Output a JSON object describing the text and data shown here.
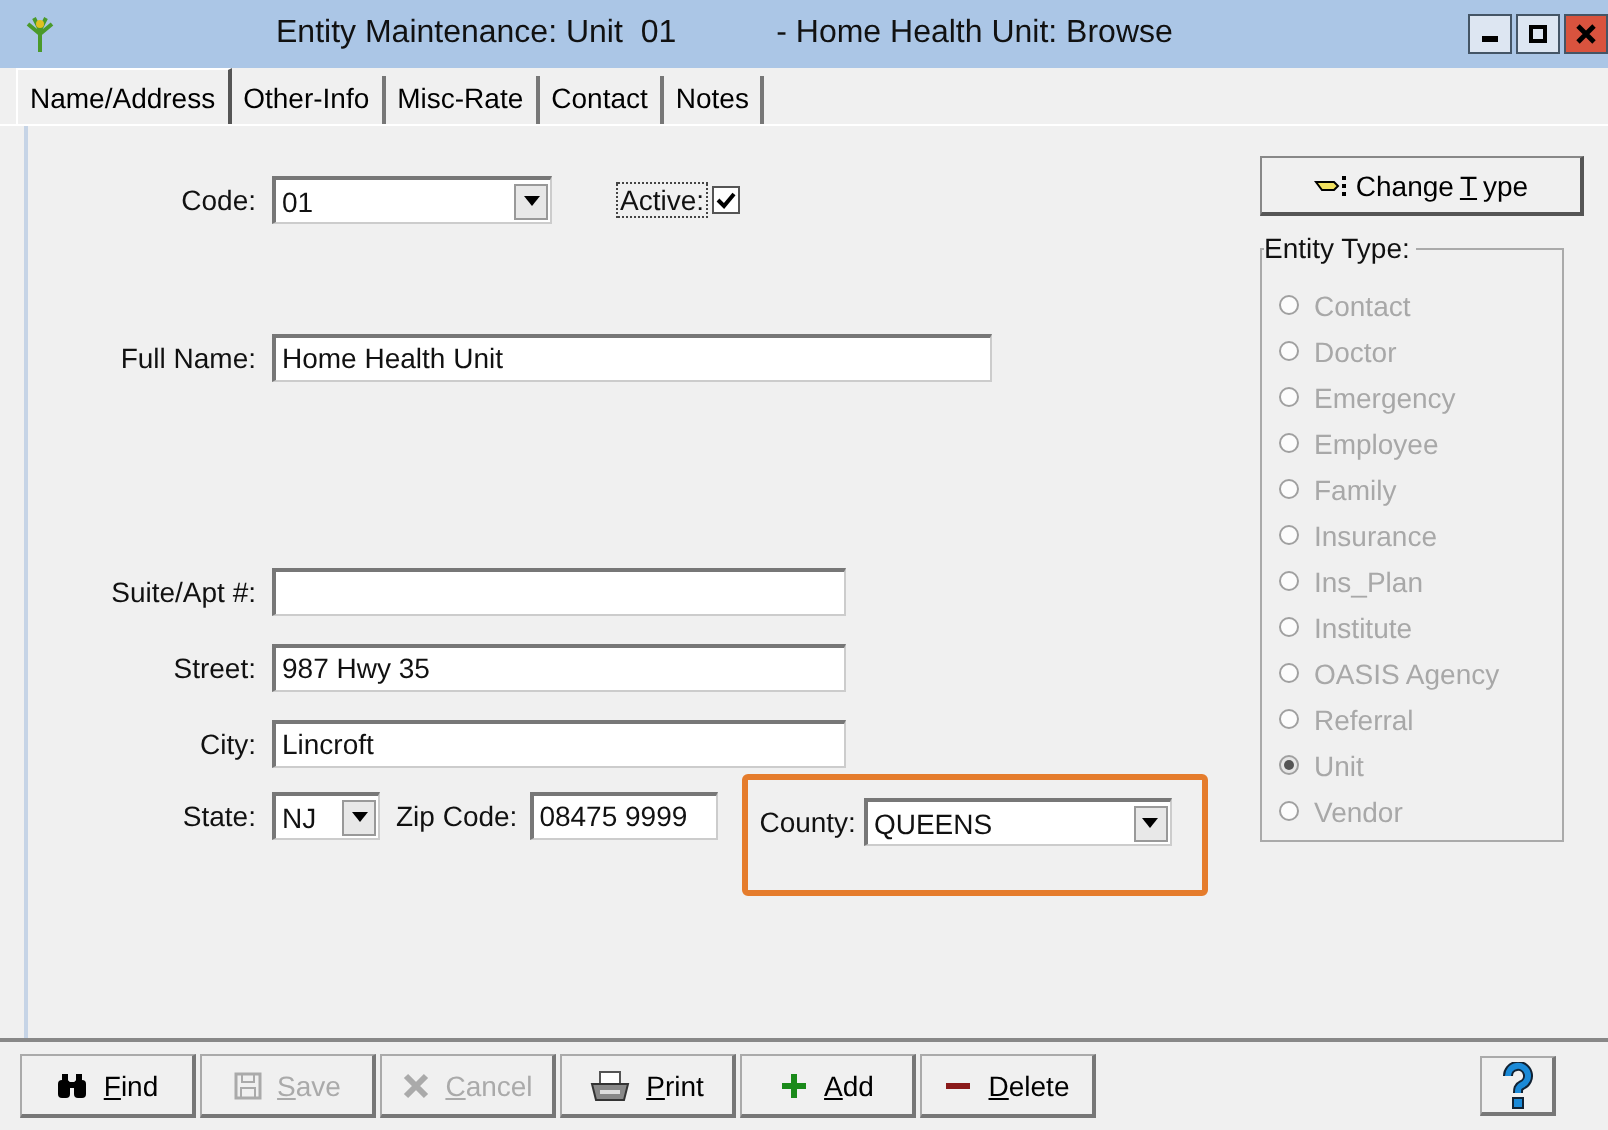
{
  "window": {
    "title": "Entity Maintenance: Unit  01",
    "subtitle": "- Home Health Unit: Browse"
  },
  "tabs": [
    {
      "label": "Name/Address",
      "selected": true
    },
    {
      "label": "Other-Info",
      "selected": false
    },
    {
      "label": "Misc-Rate",
      "selected": false
    },
    {
      "label": "Contact",
      "selected": false
    },
    {
      "label": "Notes",
      "selected": false
    }
  ],
  "form": {
    "code": {
      "label": "Code:",
      "value": "01"
    },
    "active": {
      "label": "Active:",
      "checked": true
    },
    "full_name": {
      "label": "Full Name:",
      "value": "Home Health Unit"
    },
    "suite": {
      "label": "Suite/Apt #:"
    },
    "street": {
      "label": "Street:",
      "value": "987 Hwy 35"
    },
    "city": {
      "label": "City:",
      "value": "Lincroft"
    },
    "state": {
      "label": "State:",
      "value": "NJ"
    },
    "zip": {
      "label": "Zip Code:",
      "value": "08475 9999"
    },
    "county": {
      "label": "County:",
      "value": "QUEENS",
      "highlighted": true
    }
  },
  "change_type": {
    "before": "Change ",
    "key": "T",
    "after": "ype"
  },
  "entity_type": {
    "title": "Entity Type:",
    "disabled": true,
    "options": [
      {
        "label": "Contact",
        "selected": false
      },
      {
        "label": "Doctor",
        "selected": false
      },
      {
        "label": "Emergency",
        "selected": false
      },
      {
        "label": "Employee",
        "selected": false
      },
      {
        "label": "Family",
        "selected": false
      },
      {
        "label": "Insurance",
        "selected": false
      },
      {
        "label": "Ins_Plan",
        "selected": false
      },
      {
        "label": "Institute",
        "selected": false
      },
      {
        "label": "OASIS Agency",
        "selected": false
      },
      {
        "label": "Referral",
        "selected": false
      },
      {
        "label": "Unit",
        "selected": true
      },
      {
        "label": "Vendor",
        "selected": false
      }
    ]
  },
  "toolbar": [
    {
      "kind": "find",
      "key": "F",
      "after": "ind",
      "disabled": false
    },
    {
      "kind": "save",
      "key": "S",
      "after": "ave",
      "disabled": true
    },
    {
      "kind": "cancel",
      "key": "C",
      "after": "ancel",
      "disabled": true
    },
    {
      "kind": "print",
      "key": "P",
      "after": "rint",
      "disabled": false
    },
    {
      "kind": "add",
      "key": "A",
      "after": "dd",
      "disabled": false
    },
    {
      "kind": "delete",
      "key": "D",
      "after": "elete",
      "disabled": false
    }
  ]
}
